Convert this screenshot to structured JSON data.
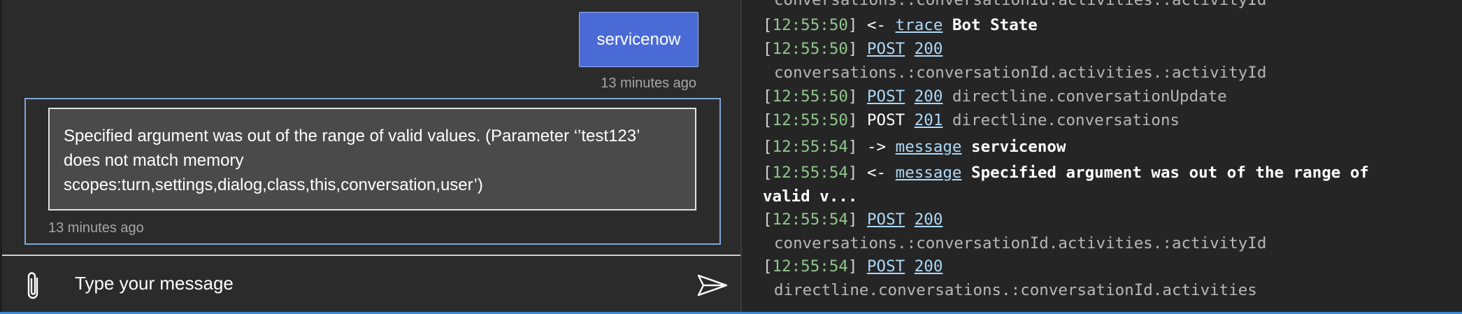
{
  "chat": {
    "user_message": "servicenow",
    "user_time": "13 minutes ago",
    "bot_message_line1": "Specified argument was out of the range of valid values. (Parameter ‘’test123’",
    "bot_message_line2": "does not match memory",
    "bot_message_line3": "scopes:turn,settings,dialog,class,this,conversation,user’)",
    "bot_time": "13 minutes ago",
    "input_placeholder": "Type your message",
    "attach_icon": "paperclip-icon",
    "send_icon": "send-icon"
  },
  "log": {
    "cut_top": "conversations.:conversationId.activities.:activityId",
    "l1_ts": "12:55:50",
    "l1_dir": "<-",
    "l1_type": "trace",
    "l1_text": "Bot State",
    "l2_ts": "12:55:50",
    "l2_method": "POST",
    "l2_code": "200",
    "l2_path": "conversations.:conversationId.activities.:activityId",
    "l3_ts": "12:55:50",
    "l3_method": "POST",
    "l3_code": "200",
    "l3_path": "directline.conversationUpdate",
    "l4_ts": "12:55:50",
    "l4_method": "POST",
    "l4_code": "201",
    "l4_path": "directline.conversations",
    "l5_ts": "12:55:54",
    "l5_dir": "->",
    "l5_type": "message",
    "l5_text": "servicenow",
    "l6_ts": "12:55:54",
    "l6_dir": "<-",
    "l6_type": "message",
    "l6_text": "Specified argument was out of the range of",
    "l6_cont": "valid v...",
    "l7_ts": "12:55:54",
    "l7_method": "POST",
    "l7_code": "200",
    "l7_path": "conversations.:conversationId.activities.:activityId",
    "l8_ts": "12:55:54",
    "l8_method": "POST",
    "l8_code": "200",
    "l8_path": "directline.conversations.:conversationId.activities"
  },
  "colors": {
    "user_bubble": "#4a6bd6",
    "timestamp": "#8fc78a",
    "link": "#add8f6",
    "accent_strip": "#3a8bd8"
  }
}
